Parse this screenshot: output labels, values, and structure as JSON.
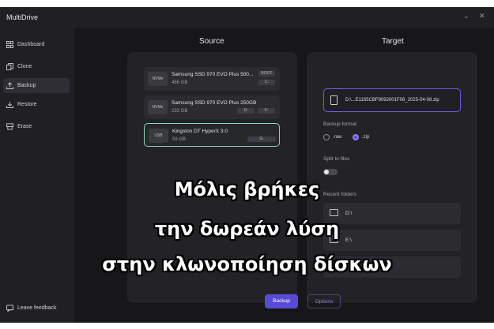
{
  "app": {
    "title": "MultiDrive"
  },
  "sidebar": {
    "items": [
      {
        "label": "Dashboard",
        "icon": "grid-icon"
      },
      {
        "label": "Clone",
        "icon": "copy-icon"
      },
      {
        "label": "Backup",
        "icon": "upload-icon",
        "active": true
      },
      {
        "label": "Restore",
        "icon": "download-icon"
      },
      {
        "label": "Erase",
        "icon": "erase-icon"
      }
    ],
    "feedback": "Leave feedback"
  },
  "source": {
    "title": "Source",
    "disks": [
      {
        "badge": "NVMe",
        "name": "Samsung SSD 970 EVO Plus 500...",
        "size": "466 GB",
        "tags": [
          "BOOT",
          "C:"
        ]
      },
      {
        "badge": "NVMe",
        "name": "Samsung SSD 970 EVO Plus 250GB",
        "size": "233 GB",
        "tags": [
          "D:",
          "F:"
        ]
      },
      {
        "badge": "USB",
        "name": "Kingston DT HyperX 3.0",
        "size": "59 GB",
        "tags": [
          "G:"
        ],
        "selected": true
      }
    ]
  },
  "target": {
    "title": "Target",
    "file_path": "D:\\...E1165CBF9092001F08_2025-04-08.zip",
    "backup_format_label": "Backup format",
    "format_options": [
      ".raw",
      ".zip"
    ],
    "selected_format": ".zip",
    "split_label": "Split to files",
    "recent_label": "Recent folders",
    "recent": [
      "D:\\",
      "E:\\",
      "F:\\"
    ]
  },
  "footer": {
    "primary": "Backup",
    "secondary": "Options"
  },
  "overlay": {
    "line1": "Μόλις βρήκες",
    "line2": "την δωρεάν λύση",
    "line3": "στην κλωνοποίηση δίσκων"
  },
  "colors": {
    "accent": "#5a4bd6",
    "selected_border": "#8fd3b5",
    "background": "#17171a"
  }
}
